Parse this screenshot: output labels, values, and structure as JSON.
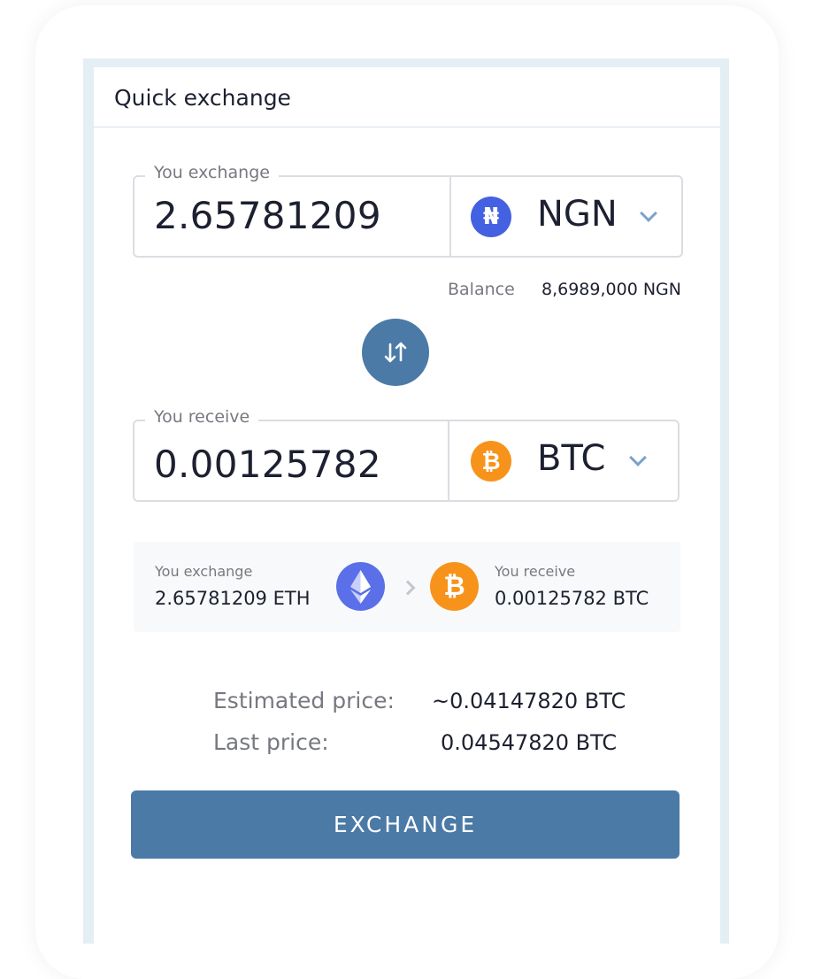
{
  "panel": {
    "title": "Quick exchange"
  },
  "exchange_field": {
    "legend": "You exchange",
    "amount": "2.65781209",
    "currency": "NGN",
    "currency_symbol": "₦",
    "icon": "naira-coin-icon",
    "icon_color": "#4361e0"
  },
  "balance": {
    "label": "Balance",
    "value": "8,6989,000 NGN"
  },
  "swap": {
    "icon": "swap-arrows-icon"
  },
  "receive_field": {
    "legend": "You receive",
    "amount": "0.00125782",
    "currency": "BTC",
    "currency_symbol": "₿",
    "icon": "bitcoin-coin-icon",
    "icon_color": "#f7931a"
  },
  "summary": {
    "from_label": "You exchange",
    "from_value": "2.65781209 ETH",
    "from_icon": "ethereum-coin-icon",
    "from_icon_color": "#5a6fe8",
    "to_label": "You receive",
    "to_value": "0.00125782 BTC",
    "to_icon": "bitcoin-coin-icon",
    "to_icon_color": "#f7931a"
  },
  "prices": {
    "estimated_label": "Estimated price:",
    "estimated_value": "~0.04147820 BTC",
    "last_label": "Last price:",
    "last_value": "0.04547820 BTC"
  },
  "action": {
    "label": "EXCHANGE",
    "color": "#4b7aa6"
  }
}
